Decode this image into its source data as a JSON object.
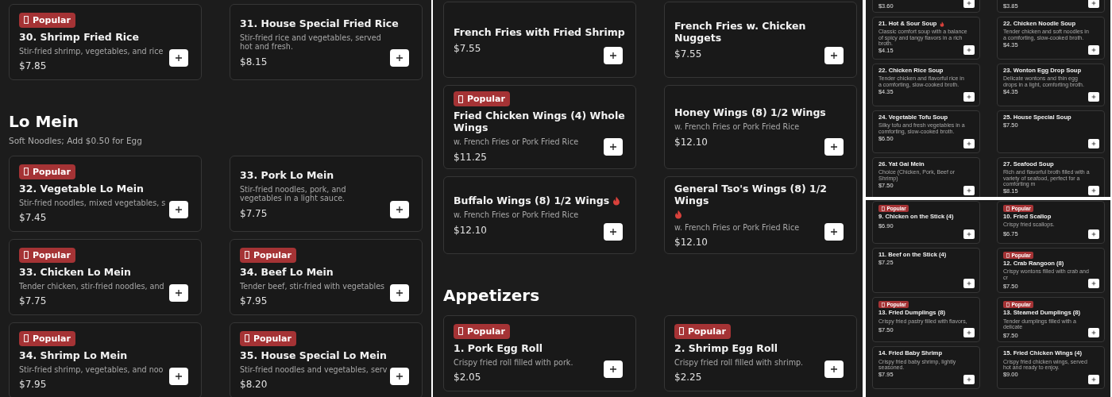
{
  "panels": [
    {
      "sections": [
        {
          "cards": [
            {
              "badge": "Popular",
              "title": "30. Shrimp Fried Rice",
              "description": "Stir-fried shrimp, vegetables, and rice",
              "price": "$7.85"
            },
            {
              "title": "31. House Special Fried Rice",
              "description": "Stir-fried rice and vegetables, served hot and fresh.",
              "price": "$8.15"
            }
          ]
        },
        {
          "heading": "Lo Mein",
          "subtitle": "Soft Noodles; Add $0.50 for Egg",
          "cards": [
            {
              "badge": "Popular",
              "title": "32. Vegetable Lo Mein",
              "description": "Stir-fried noodles, mixed vegetables, s",
              "price": "$7.45"
            },
            {
              "title": "33. Pork Lo Mein",
              "description": "Stir-fried noodles, pork, and vegetables in a light sauce.",
              "price": "$7.75"
            },
            {
              "badge": "Popular",
              "title": "33. Chicken Lo Mein",
              "description": "Tender chicken, stir-fried noodles, and",
              "price": "$7.75"
            },
            {
              "badge": "Popular",
              "title": "34. Beef Lo Mein",
              "description": "Tender beef, stir-fried with vegetables",
              "price": "$7.95"
            },
            {
              "badge": "Popular",
              "title": "34. Shrimp Lo Mein",
              "description": "Stir-fried shrimp, vegetables, and noo",
              "price": "$7.95"
            },
            {
              "badge": "Popular",
              "title": "35. House Special Lo Mein",
              "description": "Stir-fried noodles and vegetables, serv",
              "price": "$8.20"
            }
          ]
        }
      ]
    },
    {
      "sections": [
        {
          "cards": [
            {
              "title": "French Fries with Fried Shrimp",
              "price": "$7.55"
            },
            {
              "title": "French Fries w. Chicken Nuggets",
              "price": "$7.55"
            },
            {
              "badge": "Popular",
              "title": "Fried Chicken Wings (4) Whole Wings",
              "description": "w. French Fries or Pork Fried Rice",
              "price": "$11.25"
            },
            {
              "title": "Honey Wings (8) 1/2 Wings",
              "description": "w. French Fries or Pork Fried Rice",
              "price": "$12.10"
            },
            {
              "title": "Buffalo Wings (8) 1/2 Wings",
              "spicy": true,
              "description": "w. French Fries or Pork Fried Rice",
              "price": "$12.10"
            },
            {
              "title": "General Tso's Wings (8) 1/2 Wings",
              "spicy": true,
              "description": "w. French Fries or Pork Fried Rice",
              "price": "$12.10"
            }
          ]
        },
        {
          "heading": "Appetizers",
          "cards": [
            {
              "badge": "Popular",
              "title": "1. Pork Egg Roll",
              "description": "Crispy fried roll filled with pork.",
              "price": "$2.05"
            },
            {
              "badge": "Popular",
              "title": "2. Shrimp Egg Roll",
              "description": "Crispy fried roll filled with shrimp.",
              "price": "$2.25"
            }
          ]
        }
      ]
    },
    {
      "sections": [
        {
          "cards": [
            {
              "price": "$3.60"
            },
            {
              "price": "$3.85"
            },
            {
              "title": "21. Hot & Sour Soup",
              "spicy": true,
              "description": "Classic comfort soup with a balance of spicy and tangy flavors in a rich broth.",
              "price": "$4.15"
            },
            {
              "title": "22. Chicken Noodle Soup",
              "description": "Tender chicken and soft noodles in a comforting, slow-cooked broth.",
              "price": "$4.35"
            },
            {
              "title": "22. Chicken Rice Soup",
              "description": "Tender chicken and flavorful rice in a comforting, slow-cooked broth.",
              "price": "$4.35"
            },
            {
              "title": "23. Wonton Egg Drop Soup",
              "description": "Delicate wontons and thin egg drops in a light, comforting broth.",
              "price": "$4.35"
            },
            {
              "title": "24. Vegetable Tofu Soup",
              "description": "Silky tofu and fresh vegetables in a comforting, slow-cooked broth.",
              "price": "$6.50"
            },
            {
              "title": "25. House Special Soup",
              "price": "$7.50"
            },
            {
              "title": "26. Yat Gai Mein",
              "description": "Choice (Chicken, Pork, Beef or Shrimp)",
              "price": "$7.50"
            },
            {
              "title": "27. Seafood Soup",
              "description": "Rich and flavorful broth filled with a variety of seafood, perfect for a comforting m",
              "price": "$8.15"
            }
          ]
        }
      ]
    },
    {
      "sections": [
        {
          "cards": [
            {
              "badge": "Popular",
              "title": "9. Chicken on the Stick (4)",
              "price": "$6.90"
            },
            {
              "badge": "Popular",
              "title": "10. Fried Scallop",
              "description": "Crispy fried scallops.",
              "price": "$6.75"
            },
            {
              "title": "11. Beef on the Stick (4)",
              "price": "$7.25"
            },
            {
              "badge": "Popular",
              "title": "12. Crab Rangoon (8)",
              "description": "Crispy wontons filled with crab and cr",
              "price": "$7.50"
            },
            {
              "badge": "Popular",
              "title": "13. Fried Dumplings (8)",
              "description": "Crispy fried pastry filled with flavors,",
              "price": "$7.50"
            },
            {
              "badge": "Popular",
              "title": "13. Steamed Dumplings (8)",
              "description": "Tender dumplings filled with a delicate",
              "price": "$7.50"
            },
            {
              "title": "14. Fried Baby Shrimp",
              "description": "Crispy fried baby shrimp, lightly seasoned.",
              "price": "$7.95"
            },
            {
              "title": "15. Fried Chicken Wings (4)",
              "description": "Crispy fried chicken wings, served hot and ready to enjoy.",
              "price": "$9.00"
            }
          ]
        }
      ]
    }
  ]
}
